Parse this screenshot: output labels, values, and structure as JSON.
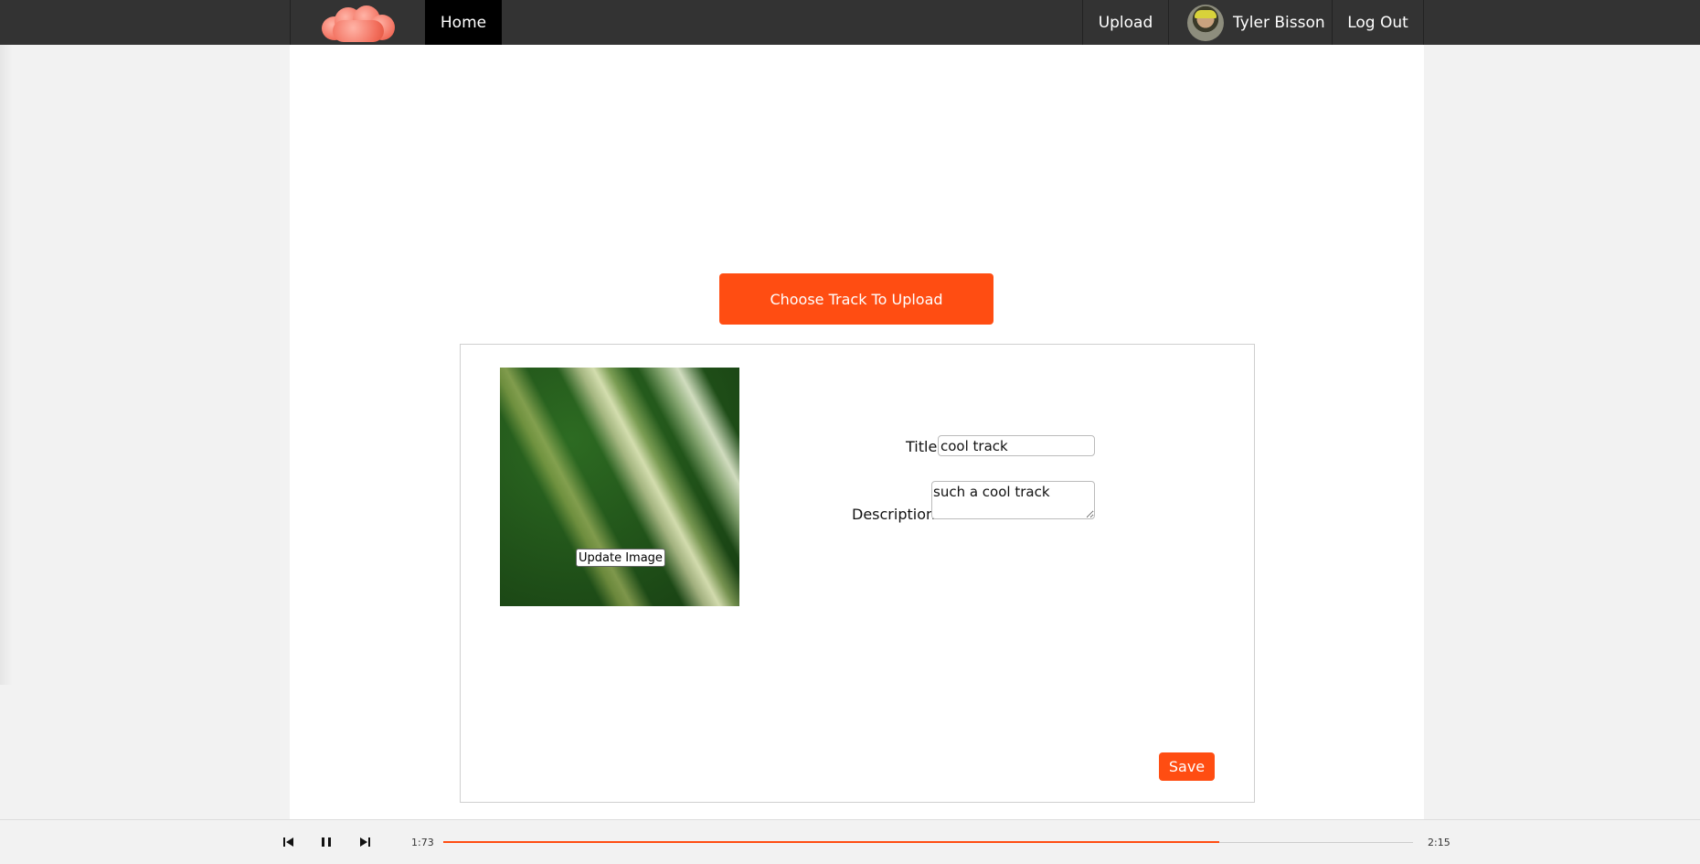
{
  "nav": {
    "home_label": "Home",
    "upload_label": "Upload",
    "user_name": "Tyler Bisson",
    "logout_label": "Log Out"
  },
  "upload": {
    "choose_track_label": "Choose Track To Upload"
  },
  "form": {
    "update_image_label": "Update Image",
    "title_label": "Title",
    "title_value": "cool track",
    "description_label": "Description",
    "description_value": "such a cool track",
    "save_label": "Save"
  },
  "player": {
    "current_time": "1:73",
    "total_time": "2:15",
    "progress": 0.8
  },
  "colors": {
    "accent": "#ff4d12",
    "nav_bg": "#333333",
    "nav_active": "#000000",
    "page_bg": "#f2f2f2",
    "content_bg": "#ffffff"
  },
  "icons": {
    "logo": "cloud-logo",
    "prev": "skip-previous-icon",
    "pause": "pause-icon",
    "next": "skip-next-icon"
  }
}
